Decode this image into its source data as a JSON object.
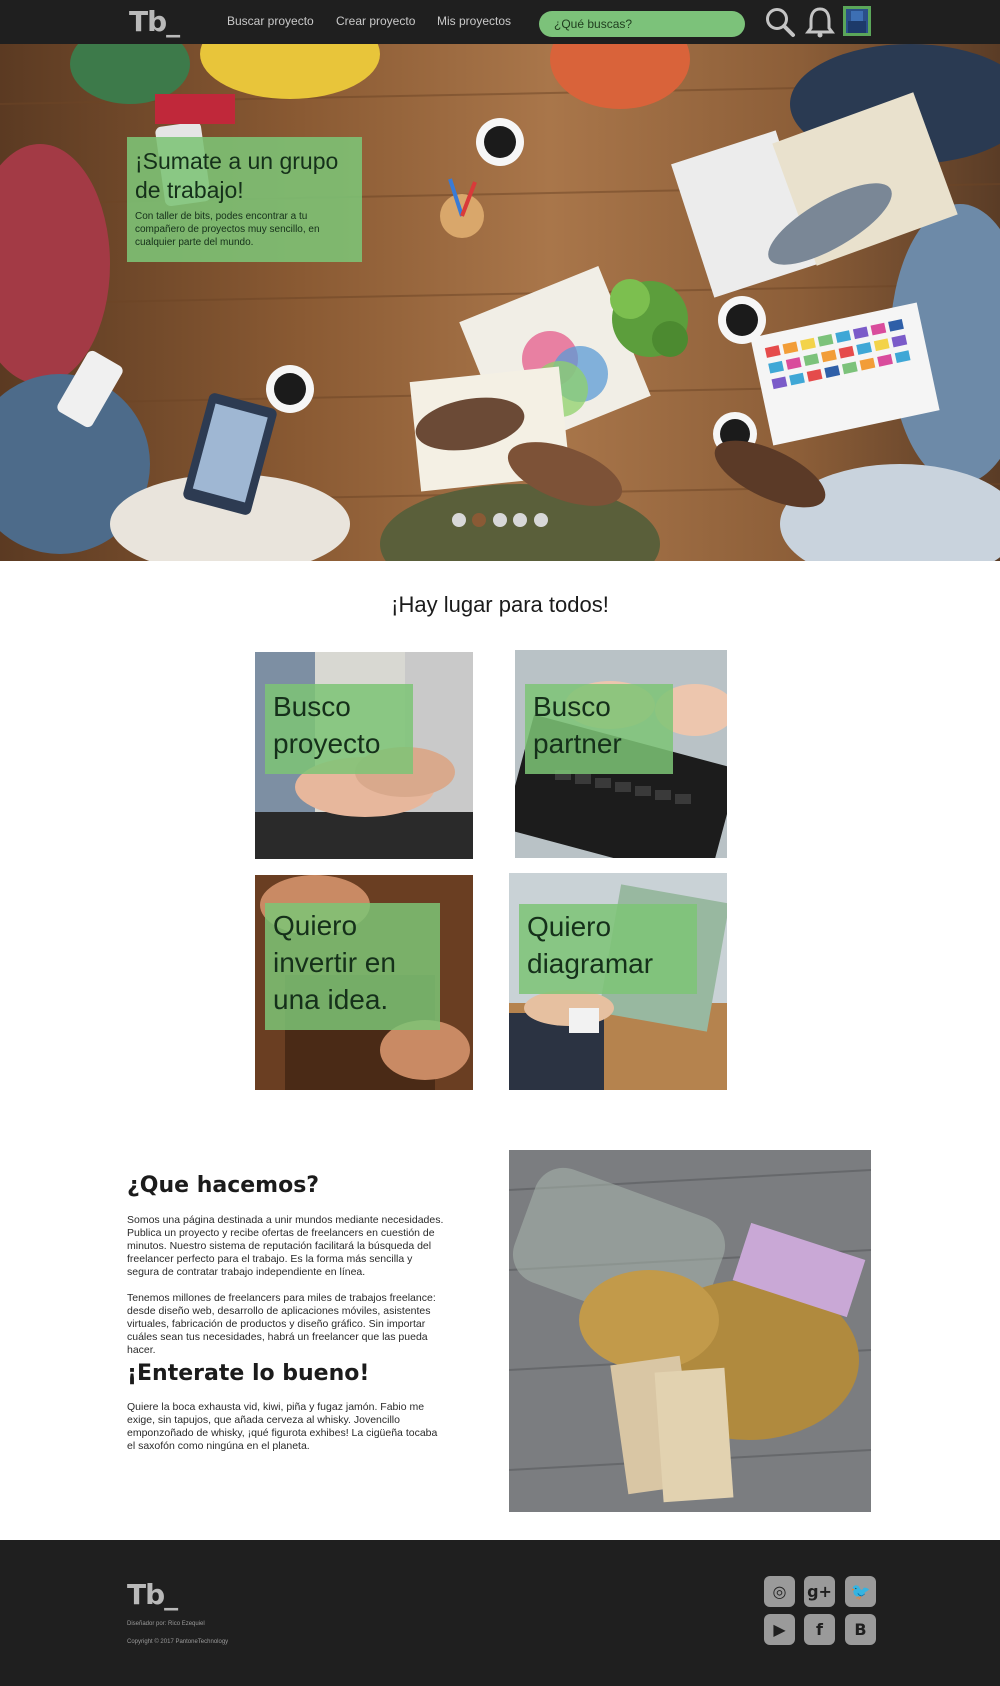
{
  "nav": {
    "logo_text": "Tb_",
    "links": [
      {
        "label": "Buscar proyecto"
      },
      {
        "label": "Crear proyecto"
      },
      {
        "label": "Mis proyectos"
      }
    ],
    "search_placeholder": "¿Qué buscas?",
    "icons": [
      "search-icon",
      "bell-icon",
      "avatar"
    ],
    "accent_color": "#7cc27a",
    "background_color": "#1f1f1f"
  },
  "hero": {
    "title": "¡Sumate a un grupo de trabajo!",
    "text": "Con taller de bits, podes encontrar a tu compañero de proyectos muy sencillo, en cualquier parte del mundo.",
    "slide_count": 5,
    "active_slide": 2
  },
  "categories": {
    "heading": "¡Hay lugar para todos!",
    "cards": [
      {
        "label": "Busco proyecto"
      },
      {
        "label": "Busco partner"
      },
      {
        "label": "Quiero invertir en una idea."
      },
      {
        "label": "Quiero diagramar"
      }
    ]
  },
  "about": {
    "heading": "¿Que hacemos?",
    "paragraph1": "Somos una página destinada a unir mundos mediante necesidades. Publica un proyecto y recibe ofertas de freelancers en cuestión de minutos. Nuestro sistema de reputación facilitará la búsqueda del freelancer perfecto para el trabajo. Es la forma más sencilla y segura de contratar trabajo independiente en línea.",
    "paragraph2": "Tenemos millones de freelancers para miles de trabajos freelance: desde diseño web, desarrollo de aplicaciones móviles, asistentes virtuales, fabricación de productos y diseño gráfico. Sin importar cuáles sean tus necesidades, habrá un freelancer que las pueda hacer.",
    "heading2": "¡Enterate lo bueno!",
    "paragraph3": "Quiere la boca exhausta vid, kiwi, piña y fugaz jamón. Fabio me exige, sin tapujos, que añada cerveza al whisky. Jovencillo emponzoñado de whisky, ¡qué figurota exhibes! La cigüeña tocaba el saxofón como ningúna en el planeta."
  },
  "footer": {
    "logo_text": "Tb_",
    "designer": "Diseñador por: Rico Ezequiel",
    "copyright": "Copyright © 2017 PantoneTechnology",
    "social": [
      {
        "icon": "instagram-icon",
        "glyph": "◎"
      },
      {
        "icon": "google-plus-icon",
        "glyph": "g+"
      },
      {
        "icon": "twitter-icon",
        "glyph": "🐦"
      },
      {
        "icon": "youtube-icon",
        "glyph": "▶"
      },
      {
        "icon": "facebook-icon",
        "glyph": "f"
      },
      {
        "icon": "blogger-icon",
        "glyph": "B"
      }
    ]
  }
}
